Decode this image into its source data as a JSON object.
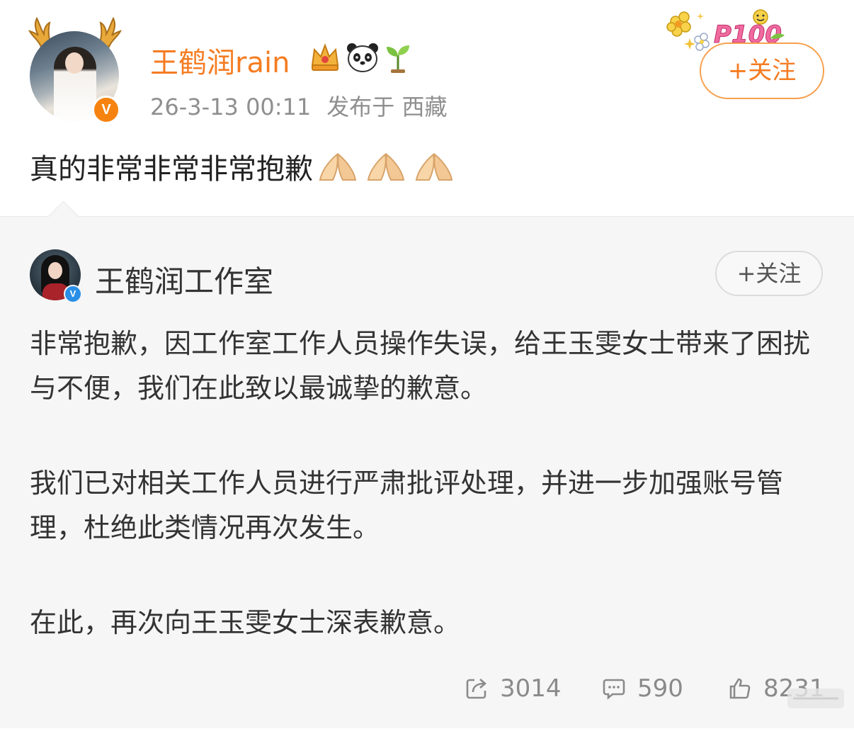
{
  "post": {
    "username": "王鹤润rain",
    "verified_badge": "V",
    "user_icons": [
      "crown-icon",
      "panda-icon",
      "sprout-icon"
    ],
    "timestamp": "26-3-13 00:11",
    "location": "发布于 西藏",
    "follow_label": "+关注",
    "text": "真的非常非常非常抱歉",
    "emoji": [
      "folded-hands-icon",
      "folded-hands-icon",
      "folded-hands-icon"
    ]
  },
  "retweet": {
    "username": "王鹤润工作室",
    "verified_badge": "V",
    "follow_label": "+关注",
    "paragraphs": [
      "非常抱歉，因工作室工作人员操作失误，给王玉雯女士带来了困扰与不便，我们在此致以最诚挚的歉意。",
      "我们已对相关工作人员进行严肃批评处理，并进一步加强账号管理，杜绝此类情况再次发生。",
      "在此，再次向王玉雯女士深表歉意。"
    ],
    "stats": {
      "reposts": "3014",
      "comments": "590",
      "likes": "8231"
    }
  },
  "colors": {
    "username_orange": "#f57c22",
    "verified_orange": "#f6830f",
    "verified_blue": "#2a8fe6",
    "retweet_bg": "#f6f6f6"
  }
}
